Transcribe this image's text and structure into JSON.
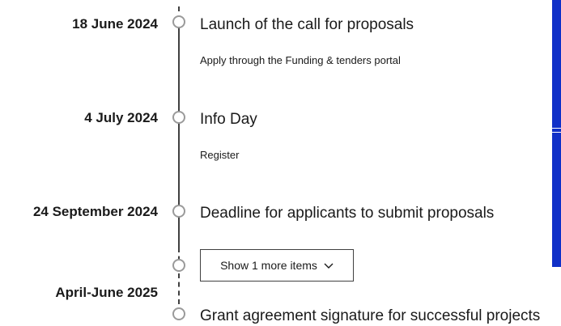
{
  "timeline": {
    "events": [
      {
        "date": "18 June 2024",
        "title": "Launch of the call for proposals",
        "link": "Apply through the Funding & tenders portal"
      },
      {
        "date": "4 July 2024",
        "title": "Info Day",
        "link": "Register"
      },
      {
        "date": "24 September 2024",
        "title": "Deadline for applicants to submit proposals"
      },
      {
        "date": "April-June 2025",
        "title": "Grant agreement signature for successful projects"
      }
    ],
    "show_more_label": "Show 1 more items"
  },
  "icons": {
    "marker": "circle-marker-icon",
    "chevron": "chevron-down-icon"
  },
  "colors": {
    "side_panel": "#1030c8",
    "rail": "#404040",
    "marker": "#9a9a9a"
  }
}
